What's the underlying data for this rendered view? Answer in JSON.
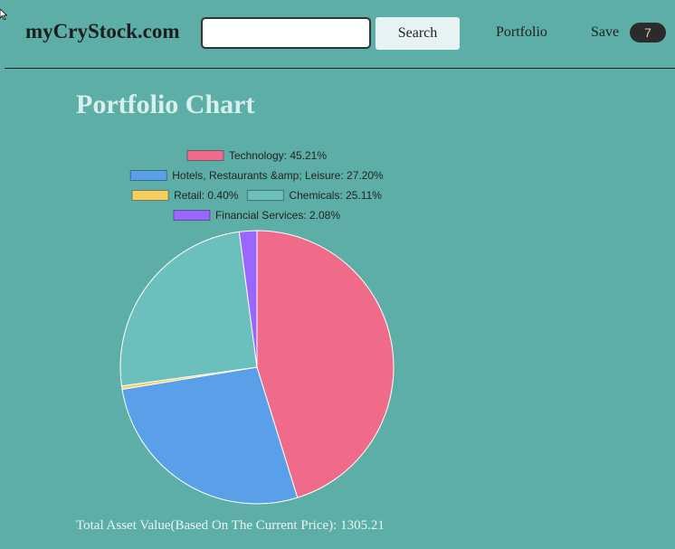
{
  "brand": "myCryStock.com",
  "search": {
    "value": "",
    "placeholder": "",
    "button_label": "Search"
  },
  "nav": {
    "portfolio_label": "Portfolio",
    "save_label": "Save",
    "save_count": "7"
  },
  "page_title": "Portfolio Chart",
  "chart_data": {
    "type": "pie",
    "legend_position": "top",
    "series": [
      {
        "name": "Technology",
        "value": 45.21,
        "label": "Technology: 45.21%",
        "color": "#f06a8a"
      },
      {
        "name": "Hotels, Restaurants &amp; Leisure",
        "value": 27.2,
        "label": "Hotels, Restaurants &amp; Leisure: 27.20%",
        "color": "#5aa0e8"
      },
      {
        "name": "Retail",
        "value": 0.4,
        "label": "Retail: 0.40%",
        "color": "#f7cf60"
      },
      {
        "name": "Chemicals",
        "value": 25.11,
        "label": "Chemicals: 25.11%",
        "color": "#6bbfbc"
      },
      {
        "name": "Financial Services",
        "value": 2.08,
        "label": "Financial Services: 2.08%",
        "color": "#9966ff"
      }
    ]
  },
  "total": {
    "label": "Total Asset Value(Based On The Current Price): ",
    "value": "1305.21"
  }
}
